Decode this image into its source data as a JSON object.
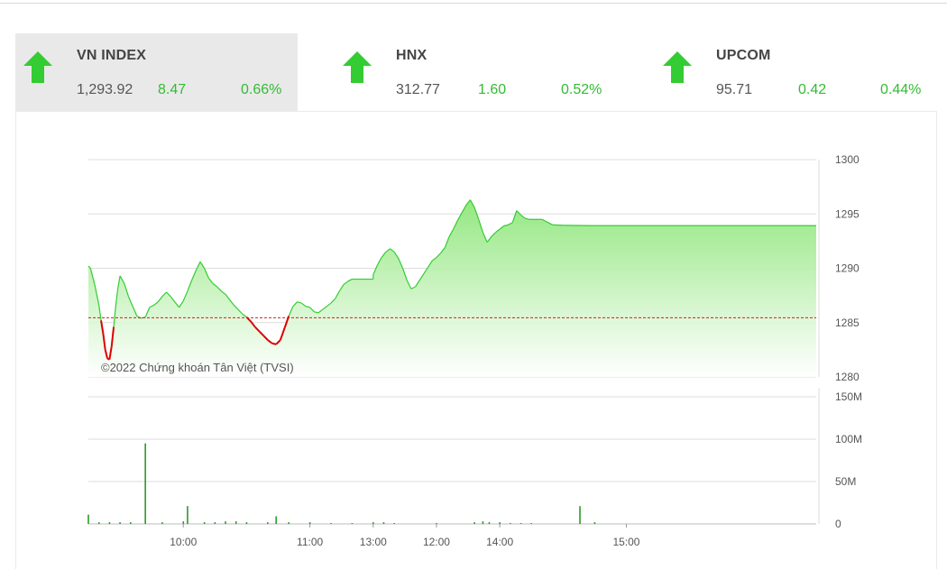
{
  "indices": [
    {
      "name": "VN INDEX",
      "value": "1,293.92",
      "change": "8.47",
      "percent": "0.66%",
      "direction": "up",
      "active": true
    },
    {
      "name": "HNX",
      "value": "312.77",
      "change": "1.60",
      "percent": "0.52%",
      "direction": "up",
      "active": false
    },
    {
      "name": "UPCOM",
      "value": "95.71",
      "change": "0.42",
      "percent": "0.44%",
      "direction": "up",
      "active": false
    }
  ],
  "colors": {
    "up": "#33cc33",
    "down": "#dd0000",
    "area_top": "#8ee67a",
    "area_bottom": "#ffffff",
    "reference": "#cc2222",
    "volume": "#2a9a2a"
  },
  "watermark": "©2022 Chứng khoán Tân Việt (TVSI)",
  "chart_data": [
    {
      "type": "area",
      "title": "",
      "ylim": [
        1280,
        1300
      ],
      "y_ticks": [
        "1300",
        "1295",
        "1290",
        "1285",
        "1280"
      ],
      "x_ticks": [
        "10:00",
        "11:00",
        "12:00",
        "13:00",
        "14:00",
        "15:00"
      ],
      "reference": 1285.45,
      "grid": true,
      "series": [
        {
          "values": [
            [
              "09:15",
              1290.2
            ],
            [
              "09:16",
              1290.0
            ],
            [
              "09:18",
              1288.5
            ],
            [
              "09:20",
              1286.6
            ],
            [
              "09:21",
              1285.2
            ],
            [
              "09:22",
              1284.0
            ],
            [
              "09:23",
              1282.5
            ],
            [
              "09:24",
              1281.7
            ],
            [
              "09:25",
              1281.6
            ],
            [
              "09:26",
              1282.8
            ],
            [
              "09:27",
              1284.6
            ],
            [
              "09:28",
              1286.6
            ],
            [
              "09:29",
              1288.2
            ],
            [
              "09:30",
              1289.3
            ],
            [
              "09:32",
              1288.6
            ],
            [
              "09:34",
              1287.4
            ],
            [
              "09:36",
              1286.5
            ],
            [
              "09:38",
              1285.6
            ],
            [
              "09:40",
              1285.4
            ],
            [
              "09:42",
              1285.5
            ],
            [
              "09:44",
              1286.4
            ],
            [
              "09:46",
              1286.6
            ],
            [
              "09:48",
              1286.9
            ],
            [
              "09:50",
              1287.4
            ],
            [
              "09:52",
              1287.8
            ],
            [
              "09:54",
              1287.4
            ],
            [
              "09:56",
              1286.9
            ],
            [
              "09:58",
              1286.4
            ],
            [
              "10:00",
              1287.0
            ],
            [
              "10:02",
              1287.9
            ],
            [
              "10:04",
              1288.9
            ],
            [
              "10:06",
              1289.8
            ],
            [
              "10:08",
              1290.6
            ],
            [
              "10:10",
              1290.0
            ],
            [
              "10:12",
              1289.1
            ],
            [
              "10:14",
              1288.6
            ],
            [
              "10:16",
              1288.3
            ],
            [
              "10:18",
              1287.9
            ],
            [
              "10:20",
              1287.6
            ],
            [
              "10:22",
              1287.1
            ],
            [
              "10:24",
              1286.6
            ],
            [
              "10:26",
              1286.2
            ],
            [
              "10:28",
              1285.8
            ],
            [
              "10:30",
              1285.5
            ],
            [
              "10:32",
              1285.1
            ],
            [
              "10:34",
              1284.6
            ],
            [
              "10:36",
              1284.2
            ],
            [
              "10:38",
              1283.8
            ],
            [
              "10:40",
              1283.4
            ],
            [
              "10:42",
              1283.1
            ],
            [
              "10:44",
              1283.0
            ],
            [
              "10:46",
              1283.4
            ],
            [
              "10:48",
              1284.5
            ],
            [
              "10:50",
              1285.6
            ],
            [
              "10:52",
              1286.5
            ],
            [
              "10:54",
              1286.9
            ],
            [
              "10:56",
              1286.8
            ],
            [
              "10:58",
              1286.5
            ],
            [
              "11:00",
              1286.4
            ],
            [
              "11:02",
              1286.0
            ],
            [
              "11:04",
              1285.9
            ],
            [
              "11:06",
              1286.2
            ],
            [
              "11:08",
              1286.5
            ],
            [
              "11:10",
              1286.8
            ],
            [
              "11:12",
              1287.2
            ],
            [
              "11:14",
              1287.9
            ],
            [
              "11:16",
              1288.5
            ],
            [
              "11:18",
              1288.8
            ],
            [
              "11:20",
              1289.0
            ],
            [
              "11:30",
              1289.0
            ],
            [
              "13:00",
              1289.4
            ],
            [
              "13:02",
              1290.3
            ],
            [
              "13:04",
              1291.0
            ],
            [
              "13:06",
              1291.5
            ],
            [
              "13:08",
              1291.8
            ],
            [
              "13:10",
              1291.5
            ],
            [
              "13:12",
              1290.9
            ],
            [
              "13:14",
              1290.0
            ],
            [
              "13:16",
              1288.9
            ],
            [
              "13:18",
              1288.1
            ],
            [
              "13:20",
              1288.3
            ],
            [
              "13:22",
              1288.9
            ],
            [
              "13:24",
              1289.5
            ],
            [
              "13:26",
              1290.1
            ],
            [
              "13:28",
              1290.7
            ],
            [
              "13:30",
              1291.0
            ],
            [
              "13:32",
              1291.4
            ],
            [
              "13:34",
              1291.9
            ],
            [
              "13:36",
              1292.9
            ],
            [
              "13:38",
              1293.6
            ],
            [
              "13:40",
              1294.4
            ],
            [
              "13:42",
              1295.1
            ],
            [
              "13:44",
              1295.8
            ],
            [
              "13:46",
              1296.3
            ],
            [
              "13:48",
              1295.6
            ],
            [
              "13:50",
              1294.5
            ],
            [
              "13:52",
              1293.3
            ],
            [
              "13:54",
              1292.4
            ],
            [
              "13:56",
              1292.9
            ],
            [
              "13:58",
              1293.3
            ],
            [
              "14:00",
              1293.6
            ],
            [
              "14:02",
              1293.9
            ],
            [
              "14:04",
              1294.0
            ],
            [
              "14:06",
              1294.2
            ],
            [
              "14:08",
              1295.3
            ],
            [
              "14:10",
              1294.9
            ],
            [
              "14:12",
              1294.6
            ],
            [
              "14:14",
              1294.5
            ],
            [
              "14:20",
              1294.5
            ],
            [
              "14:25",
              1294.0
            ],
            [
              "14:30",
              1293.95
            ],
            [
              "14:45",
              1293.92
            ]
          ]
        }
      ]
    },
    {
      "type": "bar",
      "title": "",
      "ylim": [
        0,
        150
      ],
      "y_ticks": [
        "150M",
        "100M",
        "50M",
        "0"
      ],
      "x_ticks": [
        "10:00",
        "11:00",
        "12:00",
        "13:00",
        "14:00",
        "15:00"
      ],
      "ylabel": "",
      "series": [
        {
          "values": [
            [
              "09:15",
              11
            ],
            [
              "09:20",
              2
            ],
            [
              "09:25",
              2
            ],
            [
              "09:30",
              2
            ],
            [
              "09:35",
              2
            ],
            [
              "09:42",
              95
            ],
            [
              "09:50",
              2
            ],
            [
              "10:00",
              3
            ],
            [
              "10:02",
              21
            ],
            [
              "10:10",
              2
            ],
            [
              "10:15",
              2
            ],
            [
              "10:20",
              3
            ],
            [
              "10:25",
              3
            ],
            [
              "10:30",
              2
            ],
            [
              "10:40",
              2
            ],
            [
              "10:44",
              9
            ],
            [
              "10:50",
              2
            ],
            [
              "11:00",
              2
            ],
            [
              "11:10",
              1
            ],
            [
              "11:20",
              1
            ],
            [
              "13:00",
              2
            ],
            [
              "13:05",
              2
            ],
            [
              "13:10",
              1
            ],
            [
              "13:30",
              1
            ],
            [
              "13:48",
              2
            ],
            [
              "13:52",
              3
            ],
            [
              "13:55",
              2
            ],
            [
              "14:00",
              2
            ],
            [
              "14:05",
              1
            ],
            [
              "14:10",
              1
            ],
            [
              "14:15",
              1
            ],
            [
              "14:38",
              21
            ],
            [
              "14:45",
              2
            ]
          ]
        }
      ]
    }
  ]
}
